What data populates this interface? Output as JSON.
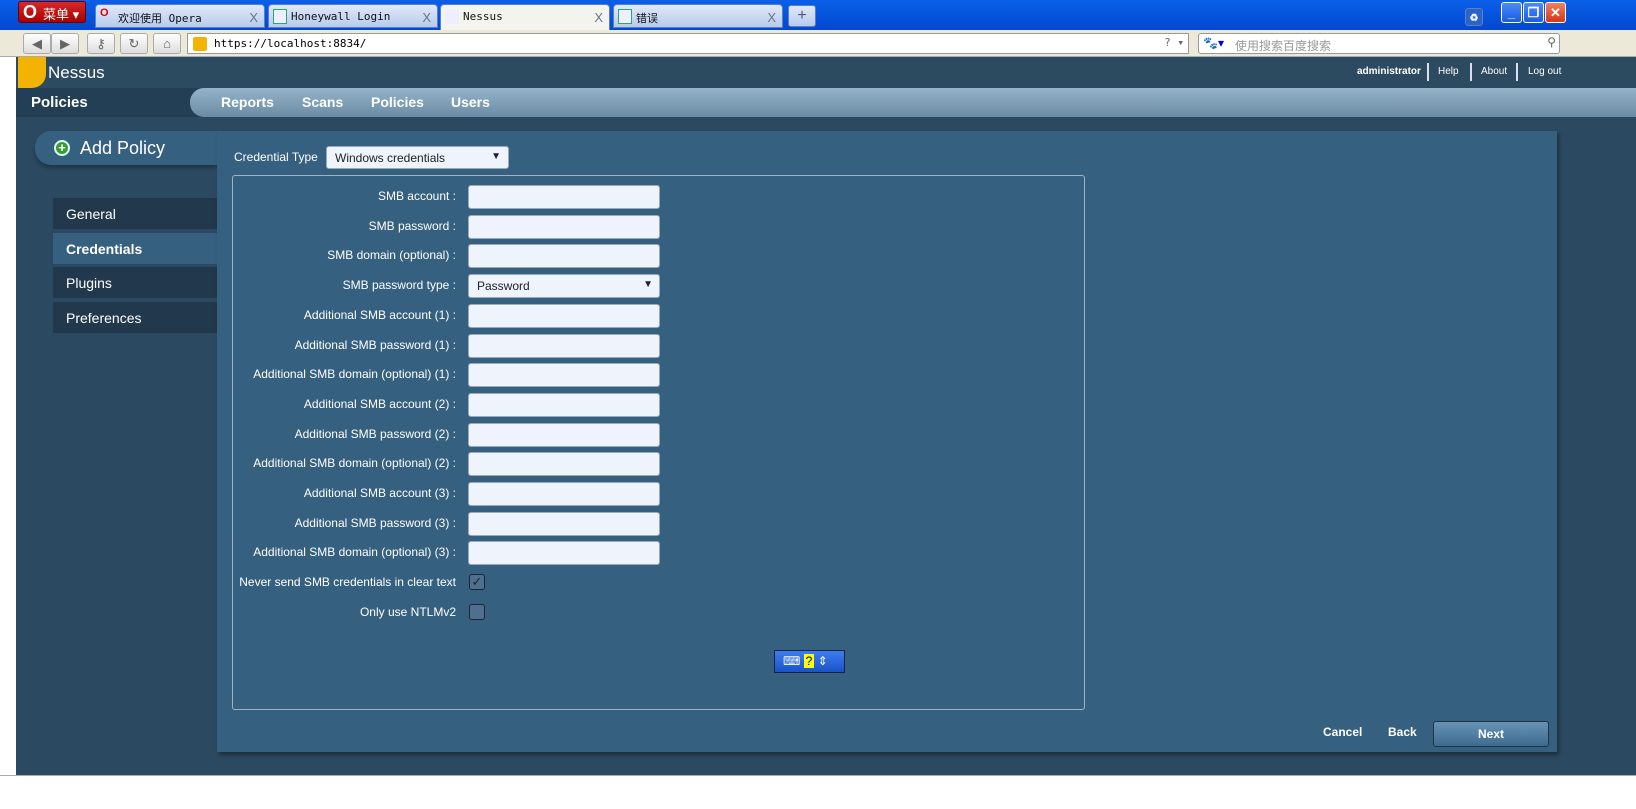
{
  "browser": {
    "menu_label": "菜单",
    "tabs": [
      {
        "title": "欢迎使用 Opera"
      },
      {
        "title": "Honeywall Login"
      },
      {
        "title": "Nessus"
      },
      {
        "title": "错误"
      }
    ],
    "url": "https://localhost:8834/",
    "search_placeholder": "使用搜索百度搜索"
  },
  "header": {
    "logo": "Nessus",
    "user": "administrator",
    "links": [
      "Help",
      "About",
      "Log out"
    ]
  },
  "nav": {
    "current": "Policies",
    "items": [
      "Reports",
      "Scans",
      "Policies",
      "Users"
    ]
  },
  "add_policy": "Add Policy",
  "sidebar": {
    "items": [
      "General",
      "Credentials",
      "Plugins",
      "Preferences"
    ],
    "active": "Credentials"
  },
  "credential_type": {
    "label": "Credential Type",
    "value": "Windows credentials"
  },
  "fields": [
    {
      "label": "SMB account :",
      "type": "text",
      "value": ""
    },
    {
      "label": "SMB password :",
      "type": "text",
      "value": ""
    },
    {
      "label": "SMB domain (optional) :",
      "type": "text",
      "value": ""
    },
    {
      "label": "SMB password type :",
      "type": "select",
      "value": "Password"
    },
    {
      "label": "Additional SMB account (1) :",
      "type": "text",
      "value": ""
    },
    {
      "label": "Additional SMB password (1) :",
      "type": "text",
      "value": ""
    },
    {
      "label": "Additional SMB domain (optional) (1) :",
      "type": "text",
      "value": ""
    },
    {
      "label": "Additional SMB account (2) :",
      "type": "text",
      "value": ""
    },
    {
      "label": "Additional SMB password (2) :",
      "type": "text",
      "value": ""
    },
    {
      "label": "Additional SMB domain (optional) (2) :",
      "type": "text",
      "value": ""
    },
    {
      "label": "Additional SMB account (3) :",
      "type": "text",
      "value": ""
    },
    {
      "label": "Additional SMB password (3) :",
      "type": "text",
      "value": ""
    },
    {
      "label": "Additional SMB domain (optional) (3) :",
      "type": "text",
      "value": ""
    },
    {
      "label": "Never send SMB credentials in clear text",
      "type": "checkbox",
      "checked": true
    },
    {
      "label": "Only use NTLMv2",
      "type": "checkbox",
      "checked": false
    }
  ],
  "footer": {
    "cancel": "Cancel",
    "back": "Back",
    "next": "Next"
  }
}
